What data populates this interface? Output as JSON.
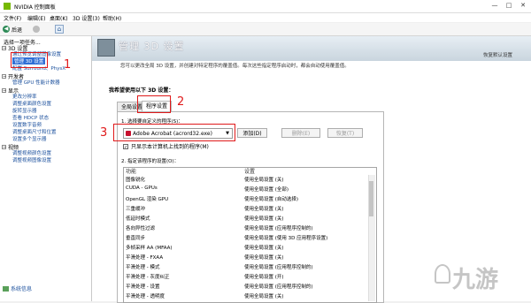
{
  "window": {
    "title": "NVIDIA 控制面板",
    "controls": [
      "—",
      "□",
      "✕"
    ]
  },
  "menu": [
    "文件(F)",
    "编辑(E)",
    "桌面(K)",
    "3D 设置(3)",
    "帮助(H)"
  ],
  "toolbar": {
    "back": "后退"
  },
  "sidebar": {
    "task_label": "选择一项任务...",
    "categories": [
      {
        "label": "3D 设置",
        "items": [
          "通过预览调整图像设置",
          "管理 3D 设置",
          "配置 Surround、PhysX"
        ]
      },
      {
        "label": "开发者",
        "items": [
          "管理 GPU 性能计数器"
        ]
      },
      {
        "label": "显示",
        "items": [
          "更改分辨率",
          "调整桌面颜色设置",
          "旋转显示器",
          "查看 HDCP 状态",
          "设置数字音频",
          "调整桌面尺寸和位置",
          "设置多个显示器"
        ]
      },
      {
        "label": "视频",
        "items": [
          "调整视频颜色设置",
          "调整视频图像设置"
        ]
      }
    ],
    "system_info": "系统信息"
  },
  "main": {
    "title": "管理 3D 设置",
    "description": "您可以更改全局 3D 设置，并创建对特定程序的覆盖值。每次这些指定程序启动时，都会自动使用覆盖值。",
    "restore_link": "恢复默认设置",
    "section_title": "我希望使用以下 3D 设置：",
    "tabs": [
      "全局设置",
      "程序设置"
    ],
    "step1": "1. 选择要自定义的程序(S)：",
    "program": "Adobe Acrobat (acrord32.exe)",
    "add_button": "添加(D)",
    "remove_button": "删除(E)",
    "restore_button": "恢复(T)",
    "show_found_label": "只显示本计算机上找到的程序(M)",
    "step2": "2. 指定该程序的设置(O)：",
    "columns": [
      "功能",
      "设置"
    ],
    "rows": [
      {
        "feature": "图像锐化",
        "setting": "使用全局设置 (关)"
      },
      {
        "feature": "CUDA - GPUs",
        "setting": "使用全局设置 (全部)"
      },
      {
        "feature": "OpenGL 渲染 GPU",
        "setting": "使用全局设置 (自动选择)"
      },
      {
        "feature": "三重缓冲",
        "setting": "使用全局设置 (关)"
      },
      {
        "feature": "低延时模式",
        "setting": "使用全局设置 (关)"
      },
      {
        "feature": "各向异性过滤",
        "setting": "使用全局设置 (应用程序控制的)"
      },
      {
        "feature": "垂直同步",
        "setting": "使用全局设置 (使用 3D 应用程序设置)"
      },
      {
        "feature": "多帧采样 AA (MFAA)",
        "setting": "使用全局设置 (关)"
      },
      {
        "feature": "平滑处理 - FXAA",
        "setting": "使用全局设置 (关)"
      },
      {
        "feature": "平滑处理 - 模式",
        "setting": "使用全局设置 (应用程序控制的)"
      },
      {
        "feature": "平滑处理 - 灰度纠正",
        "setting": "使用全局设置 (开)"
      },
      {
        "feature": "平滑处理 - 设置",
        "setting": "使用全局设置 (应用程序控制的)"
      },
      {
        "feature": "平滑处理 - 透明度",
        "setting": "使用全局设置 (关)"
      }
    ]
  },
  "annotations": [
    "1",
    "2",
    "3"
  ],
  "watermark": "九游",
  "colors": {
    "annotation": "#e0191a",
    "nvidia_green": "#76b900",
    "selection": "#2f6fd6"
  }
}
